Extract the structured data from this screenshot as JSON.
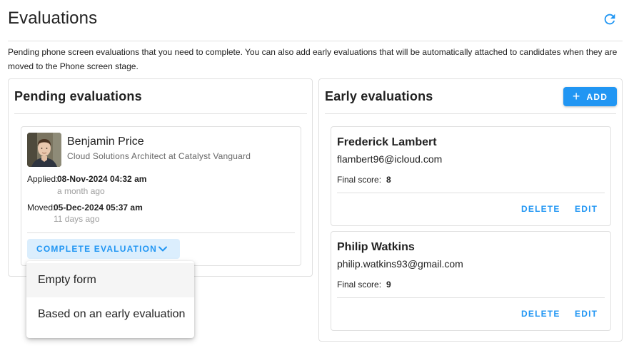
{
  "page": {
    "title": "Evaluations",
    "description": "Pending phone screen evaluations that you need to complete. You can also add early evaluations that will be automatically attached to candidates when they are moved to the Phone screen stage.",
    "refresh_icon": "refresh-icon",
    "accent_color": "#2196f3"
  },
  "pending": {
    "title": "Pending evaluations",
    "candidate": {
      "name": "Benjamin Price",
      "title": "Cloud Solutions Architect at Catalyst Vanguard",
      "applied_label": "Applied:",
      "applied_value": "08-Nov-2024 04:32 am",
      "applied_relative": "a month ago",
      "moved_label": "Moved:",
      "moved_value": "05-Dec-2024 05:37 am",
      "moved_relative": "11 days ago",
      "complete_label": "COMPLETE EVALUATION"
    },
    "dropdown": {
      "items": [
        "Empty form",
        "Based on an early evaluation"
      ]
    }
  },
  "early": {
    "title": "Early evaluations",
    "add_label": "ADD",
    "evaluations": [
      {
        "name": "Frederick Lambert",
        "email": "flambert96@icloud.com",
        "score_label": "Final score:",
        "score": "8",
        "delete_label": "DELETE",
        "edit_label": "EDIT"
      },
      {
        "name": "Philip Watkins",
        "email": "philip.watkins93@gmail.com",
        "score_label": "Final score:",
        "score": "9",
        "delete_label": "DELETE",
        "edit_label": "EDIT"
      }
    ]
  }
}
